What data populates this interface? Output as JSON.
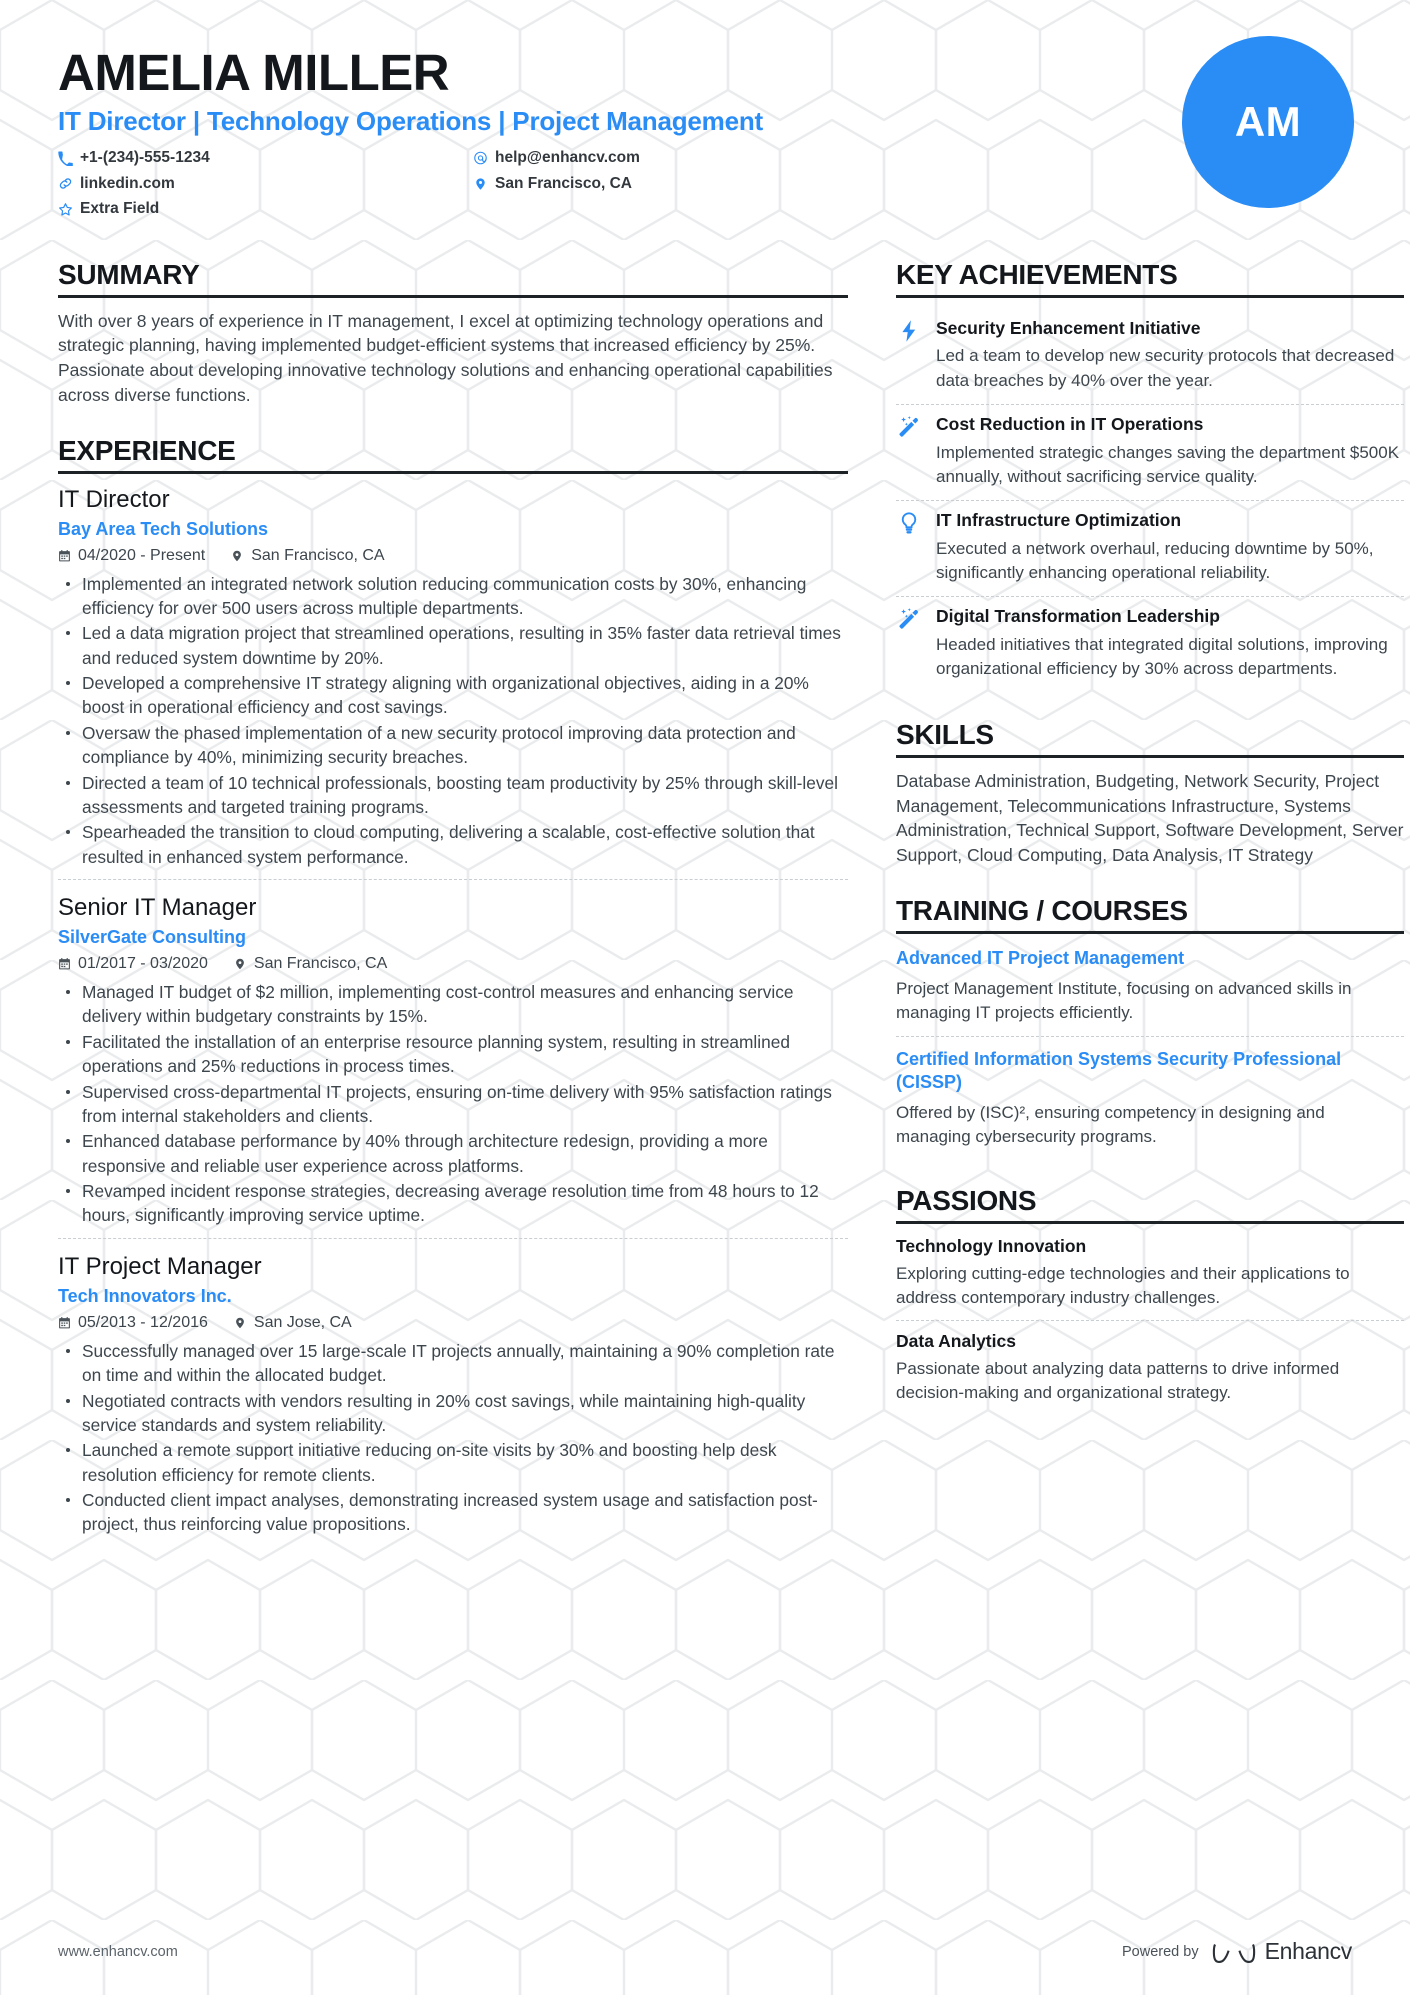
{
  "theme": {
    "accent": "#2a8cf5",
    "ink": "#14181c",
    "body_text": "#3d464d",
    "rule": "#1d2226",
    "avatar_bg": "#2a8cf5"
  },
  "header": {
    "name": "AMELIA MILLER",
    "headline": "IT Director | Technology Operations | Project Management",
    "avatar_initials": "AM",
    "contacts": [
      {
        "icon": "phone-icon",
        "value": "+1-(234)-555-1234"
      },
      {
        "icon": "email-icon",
        "value": "help@enhancv.com"
      },
      {
        "icon": "link-icon",
        "value": "linkedin.com"
      },
      {
        "icon": "location-icon",
        "value": "San Francisco, CA"
      },
      {
        "icon": "star-icon",
        "value": "Extra Field"
      }
    ]
  },
  "summary": {
    "heading": "SUMMARY",
    "text": "With over 8 years of experience in IT management, I excel at optimizing technology operations and strategic planning, having implemented budget-efficient systems that increased efficiency by 25%. Passionate about developing innovative technology solutions and enhancing operational capabilities across diverse functions."
  },
  "experience": {
    "heading": "EXPERIENCE",
    "jobs": [
      {
        "title": "IT Director",
        "company": "Bay Area Tech Solutions",
        "dates": "04/2020 - Present",
        "location": "San Francisco, CA",
        "bullets": [
          "Implemented an integrated network solution reducing communication costs by 30%, enhancing efficiency for over 500 users across multiple departments.",
          "Led a data migration project that streamlined operations, resulting in 35% faster data retrieval times and reduced system downtime by 20%.",
          "Developed a comprehensive IT strategy aligning with organizational objectives, aiding in a 20% boost in operational efficiency and cost savings.",
          "Oversaw the phased implementation of a new security protocol improving data protection and compliance by 40%, minimizing security breaches.",
          "Directed a team of 10 technical professionals, boosting team productivity by 25% through skill-level assessments and targeted training programs.",
          "Spearheaded the transition to cloud computing, delivering a scalable, cost-effective solution that resulted in enhanced system performance."
        ]
      },
      {
        "title": "Senior IT Manager",
        "company": "SilverGate Consulting",
        "dates": "01/2017 - 03/2020",
        "location": "San Francisco, CA",
        "bullets": [
          "Managed IT budget of $2 million, implementing cost-control measures and enhancing service delivery within budgetary constraints by 15%.",
          "Facilitated the installation of an enterprise resource planning system, resulting in streamlined operations and 25% reductions in process times.",
          "Supervised cross-departmental IT projects, ensuring on-time delivery with 95% satisfaction ratings from internal stakeholders and clients.",
          "Enhanced database performance by 40% through architecture redesign, providing a more responsive and reliable user experience across platforms.",
          "Revamped incident response strategies, decreasing average resolution time from 48 hours to 12 hours, significantly improving service uptime."
        ]
      },
      {
        "title": "IT Project Manager",
        "company": "Tech Innovators Inc.",
        "dates": "05/2013 - 12/2016",
        "location": "San Jose, CA",
        "bullets": [
          "Successfully managed over 15 large-scale IT projects annually, maintaining a 90% completion rate on time and within the allocated budget.",
          "Negotiated contracts with vendors resulting in 20% cost savings, while maintaining high-quality service standards and system reliability.",
          "Launched a remote support initiative reducing on-site visits by 30% and boosting help desk resolution efficiency for remote clients.",
          "Conducted client impact analyses, demonstrating increased system usage and satisfaction post-project, thus reinforcing value propositions."
        ]
      }
    ]
  },
  "key_achievements": {
    "heading": "KEY ACHIEVEMENTS",
    "items": [
      {
        "icon": "lightning-bolt-icon",
        "title": "Security Enhancement Initiative",
        "description": "Led a team to develop new security protocols that decreased data breaches by 40% over the year."
      },
      {
        "icon": "magic-wand-icon",
        "title": "Cost Reduction in IT Operations",
        "description": "Implemented strategic changes saving the department $500K annually, without sacrificing service quality."
      },
      {
        "icon": "lightbulb-icon",
        "title": "IT Infrastructure Optimization",
        "description": "Executed a network overhaul, reducing downtime by 50%, significantly enhancing operational reliability."
      },
      {
        "icon": "magic-wand-icon",
        "title": "Digital Transformation Leadership",
        "description": "Headed initiatives that integrated digital solutions, improving organizational efficiency by 30% across departments."
      }
    ]
  },
  "skills": {
    "heading": "SKILLS",
    "text": "Database Administration, Budgeting, Network Security, Project Management, Telecommunications Infrastructure, Systems Administration, Technical Support, Software Development, Server Support, Cloud Computing, Data Analysis, IT Strategy"
  },
  "training": {
    "heading": "TRAINING / COURSES",
    "courses": [
      {
        "title": "Advanced IT Project Management",
        "description": "Project Management Institute, focusing on advanced skills in managing IT projects efficiently."
      },
      {
        "title": "Certified Information Systems Security Professional (CISSP)",
        "description": "Offered by (ISC)², ensuring competency in designing and managing cybersecurity programs."
      }
    ]
  },
  "passions": {
    "heading": "PASSIONS",
    "items": [
      {
        "title": "Technology Innovation",
        "description": "Exploring cutting-edge technologies and their applications to address contemporary industry challenges."
      },
      {
        "title": "Data Analytics",
        "description": "Passionate about analyzing data patterns to drive informed decision-making and organizational strategy."
      }
    ]
  },
  "footer": {
    "url": "www.enhancv.com",
    "powered_by": "Powered by",
    "brand": "Enhancv"
  }
}
